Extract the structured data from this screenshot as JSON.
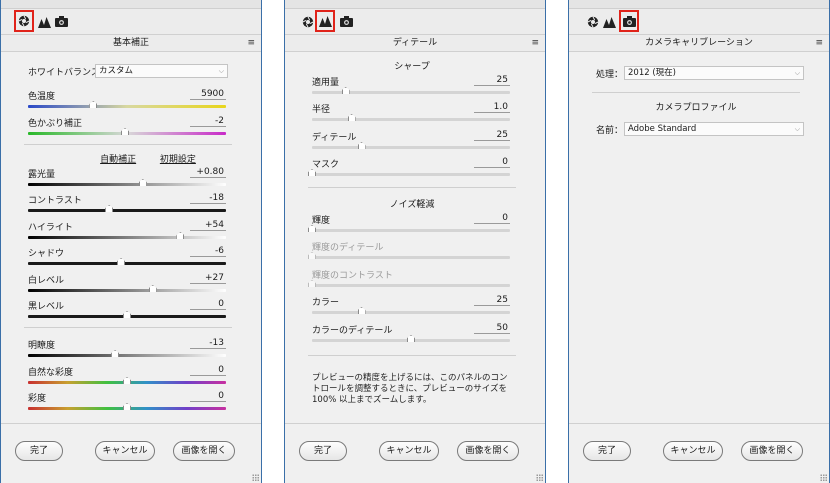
{
  "colors": {
    "selected_tab_outline": "#e0231a",
    "window_border": "#3a6fa8"
  },
  "icons": [
    "aperture-icon",
    "mountains-icon",
    "camera-icon",
    "panel-menu-icon"
  ],
  "panel1": {
    "header": "基本補正",
    "menu_icon": "≡",
    "wb_label": "ホワイトバランス：",
    "wb_value": "カスタム",
    "sliders": [
      {
        "label": "色温度",
        "value": "5900",
        "pos": 0.33
      },
      {
        "label": "色かぶり補正",
        "value": "-2",
        "pos": 0.49
      },
      {
        "label": "露光量",
        "value": "+0.80",
        "pos": 0.58
      },
      {
        "label": "コントラスト",
        "value": "-18",
        "pos": 0.41
      },
      {
        "label": "ハイライト",
        "value": "+54",
        "pos": 0.77
      },
      {
        "label": "シャドウ",
        "value": "-6",
        "pos": 0.47
      },
      {
        "label": "白レベル",
        "value": "+27",
        "pos": 0.63
      },
      {
        "label": "黒レベル",
        "value": "0",
        "pos": 0.5
      },
      {
        "label": "明瞭度",
        "value": "-13",
        "pos": 0.44
      },
      {
        "label": "自然な彩度",
        "value": "0",
        "pos": 0.5
      },
      {
        "label": "彩度",
        "value": "0",
        "pos": 0.5
      }
    ],
    "auto_label": "自動補正",
    "default_label": "初期設定"
  },
  "panel2": {
    "header": "ディテール",
    "menu_icon": "≡",
    "sharpen_title": "シャープ",
    "sharpen": [
      {
        "label": "適用量",
        "value": "25",
        "pos": 0.17
      },
      {
        "label": "半径",
        "value": "1.0",
        "pos": 0.2
      },
      {
        "label": "ディテール",
        "value": "25",
        "pos": 0.25
      },
      {
        "label": "マスク",
        "value": "0",
        "pos": 0.0
      }
    ],
    "noise_title": "ノイズ軽減",
    "noise": [
      {
        "label": "輝度",
        "value": "0",
        "pos": 0.0,
        "disabled": false
      },
      {
        "label": "輝度のディテール",
        "value": "",
        "pos": 0.0,
        "disabled": true
      },
      {
        "label": "輝度のコントラスト",
        "value": "",
        "pos": 0.0,
        "disabled": true
      },
      {
        "label": "カラー",
        "value": "25",
        "pos": 0.25,
        "disabled": false
      },
      {
        "label": "カラーのディテール",
        "value": "50",
        "pos": 0.5,
        "disabled": false
      }
    ],
    "info": "プレビューの精度を上げるには、このパネルのコントロールを調整するときに、プレビューのサイズを 100% 以上までズームします。"
  },
  "panel3": {
    "header": "カメラキャリブレーション",
    "menu_icon": "≡",
    "process_label": "処理：",
    "process_value": "2012 (現在)",
    "profile_title": "カメラプロファイル",
    "name_label": "名前：",
    "name_value": "Adobe Standard"
  },
  "buttons": {
    "done": "完了",
    "cancel": "キャンセル",
    "open": "画像を開く"
  }
}
